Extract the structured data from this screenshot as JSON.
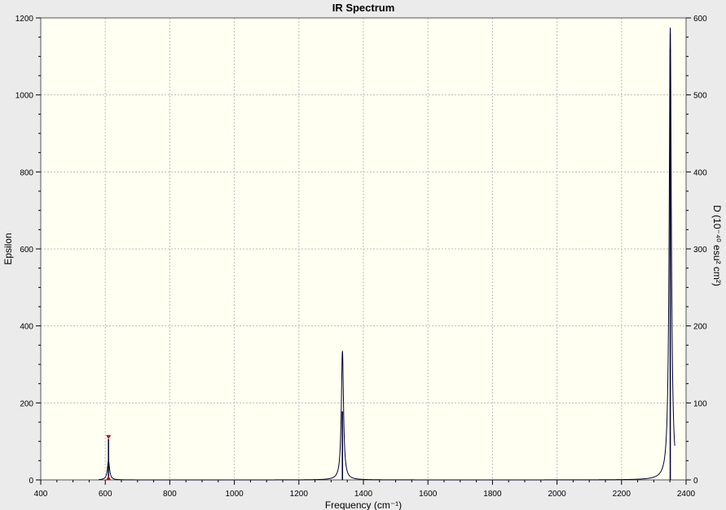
{
  "window": {
    "background": "#ebebeb",
    "plot_background": "#fffff2"
  },
  "chart_data": {
    "type": "line",
    "title": "IR Spectrum",
    "xlabel": "Frequency (cm⁻¹)",
    "ylabel": "Epsilon",
    "y2label": "D (10⁻⁴⁰ esu² cm²)",
    "xlim": [
      400,
      2400
    ],
    "ylim": [
      0,
      1200
    ],
    "y2lim": [
      0,
      600
    ],
    "x_ticks": [
      "400",
      "600",
      "800",
      "1000",
      "1200",
      "1400",
      "1600",
      "1800",
      "2000",
      "2200",
      "2400"
    ],
    "y_ticks": [
      "0",
      "200",
      "400",
      "600",
      "800",
      "1000",
      "1200"
    ],
    "y2_ticks": [
      "0",
      "100",
      "200",
      "300",
      "400",
      "500",
      "600"
    ],
    "grid": true,
    "line_color": "#000033",
    "peaks": [
      {
        "frequency": 610,
        "epsilon": 50,
        "D": 53,
        "width": 4
      },
      {
        "frequency": 1335,
        "epsilon": 335,
        "D": 89,
        "width": 4
      },
      {
        "frequency": 2351,
        "epsilon": 1175,
        "D": 560,
        "width": 4
      }
    ],
    "spectrum_range": [
      580,
      2365
    ],
    "marker": {
      "frequency": 610,
      "color": "#cc0000"
    }
  }
}
